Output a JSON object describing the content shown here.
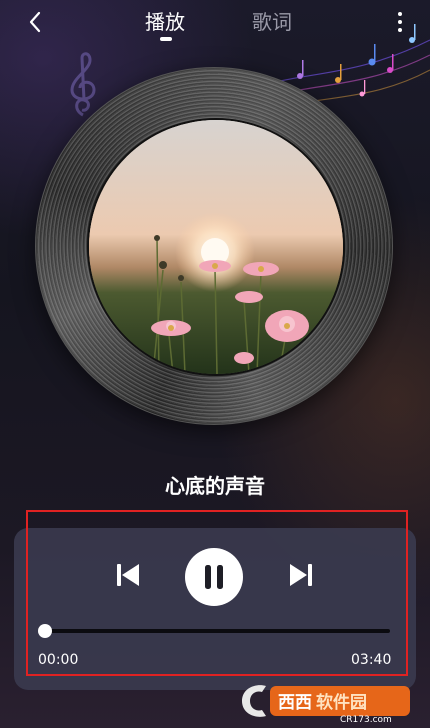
{
  "header": {
    "back_icon": "chevron-left-icon",
    "tabs": [
      {
        "label": "播放",
        "active": true
      },
      {
        "label": "歌词",
        "active": false
      }
    ],
    "more_icon": "more-vertical-icon"
  },
  "player": {
    "album_art": "flowers-sunset-image",
    "song_title": "心底的声音",
    "controls": {
      "prev_icon": "skip-previous-icon",
      "pause_icon": "pause-icon",
      "next_icon": "skip-next-icon"
    },
    "progress": {
      "fraction": 0.0,
      "current_time": "00:00",
      "total_time": "03:40"
    }
  },
  "watermark": {
    "brand": "西西软件园",
    "domain": "CR173.com"
  },
  "colors": {
    "background": "#16161f",
    "panel": "#3a3a4e",
    "accent": "#ffffff",
    "inactive_tab": "#9a9aa8",
    "highlight_border": "#e02222"
  }
}
